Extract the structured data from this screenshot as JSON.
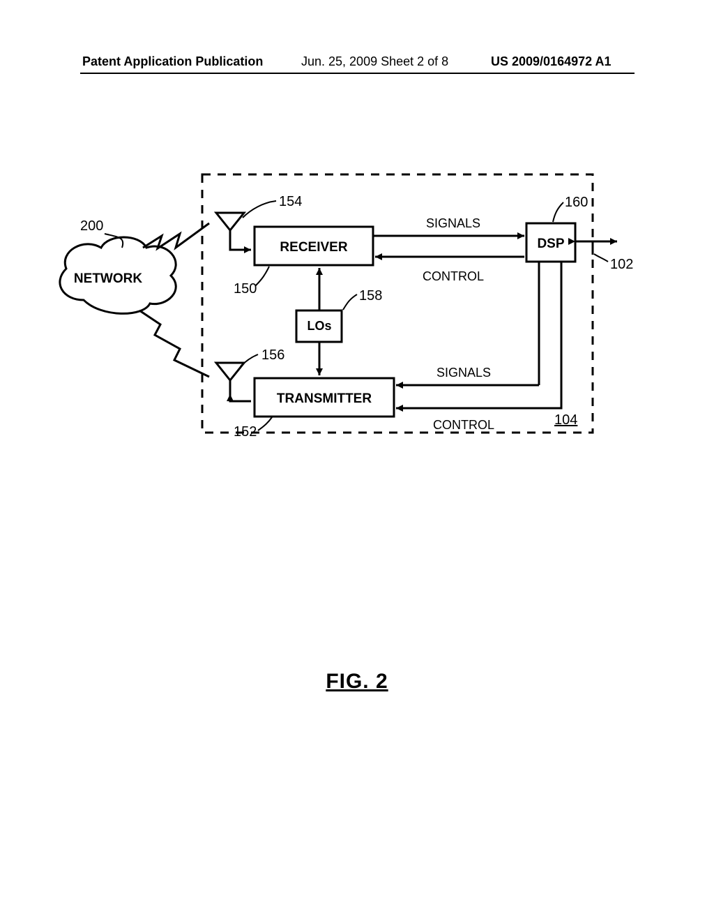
{
  "header": {
    "left": "Patent Application Publication",
    "center": "Jun. 25, 2009  Sheet 2 of 8",
    "right": "US 2009/0164972 A1"
  },
  "figure": {
    "caption": "FIG. 2"
  },
  "labels": {
    "network": "NETWORK",
    "receiver": "RECEIVER",
    "transmitter": "TRANSMITTER",
    "los": "LOs",
    "dsp": "DSP",
    "signals_top": "SIGNALS",
    "signals_bot": "SIGNALS",
    "control_top": "CONTROL",
    "control_bot": "CONTROL"
  },
  "refs": {
    "network": "200",
    "receiver": "150",
    "transmitter": "152",
    "antenna_rx": "154",
    "antenna_tx": "156",
    "los": "158",
    "dsp": "160",
    "ext": "102",
    "subsystem": "104"
  }
}
